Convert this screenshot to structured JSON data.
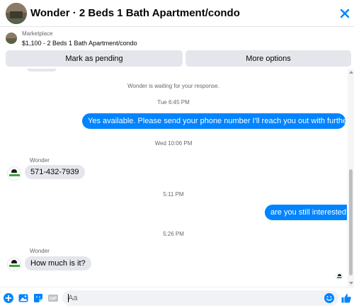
{
  "header": {
    "title": "Wonder · 2 Beds 1 Bath Apartment/condo",
    "icons": {
      "avatar": "listing-photo",
      "close": "close-icon"
    }
  },
  "listing": {
    "label": "Marketplace",
    "description": "$1,100 - 2 Beds 1 Bath Apartment/condo"
  },
  "actions": {
    "mark_pending": "Mark as pending",
    "more_options": "More options"
  },
  "conversation": {
    "waiting_note": "Wonder is waiting for your response.",
    "messages": [
      {
        "timestamp": "Tue 6:45 PM",
        "direction": "out",
        "text": "Yes available. Please send your phone number  I'll reach you out with further details"
      },
      {
        "timestamp": "Wed 10:06 PM",
        "direction": "in",
        "sender": "Wonder",
        "text": "571-432-7939"
      },
      {
        "timestamp": "5:11 PM",
        "direction": "out",
        "text": "are you still interested?"
      },
      {
        "timestamp": "5:26 PM",
        "direction": "in",
        "sender": "Wonder",
        "text": "How much is it?"
      }
    ]
  },
  "composer": {
    "placeholder": "Aa",
    "icons": [
      "plus-icon",
      "image-icon",
      "sticker-icon",
      "gif-icon",
      "emoji-icon",
      "like-icon"
    ]
  },
  "colors": {
    "accent": "#0084ff",
    "incoming_bubble": "#e4e6eb",
    "muted_text": "#65676b"
  }
}
